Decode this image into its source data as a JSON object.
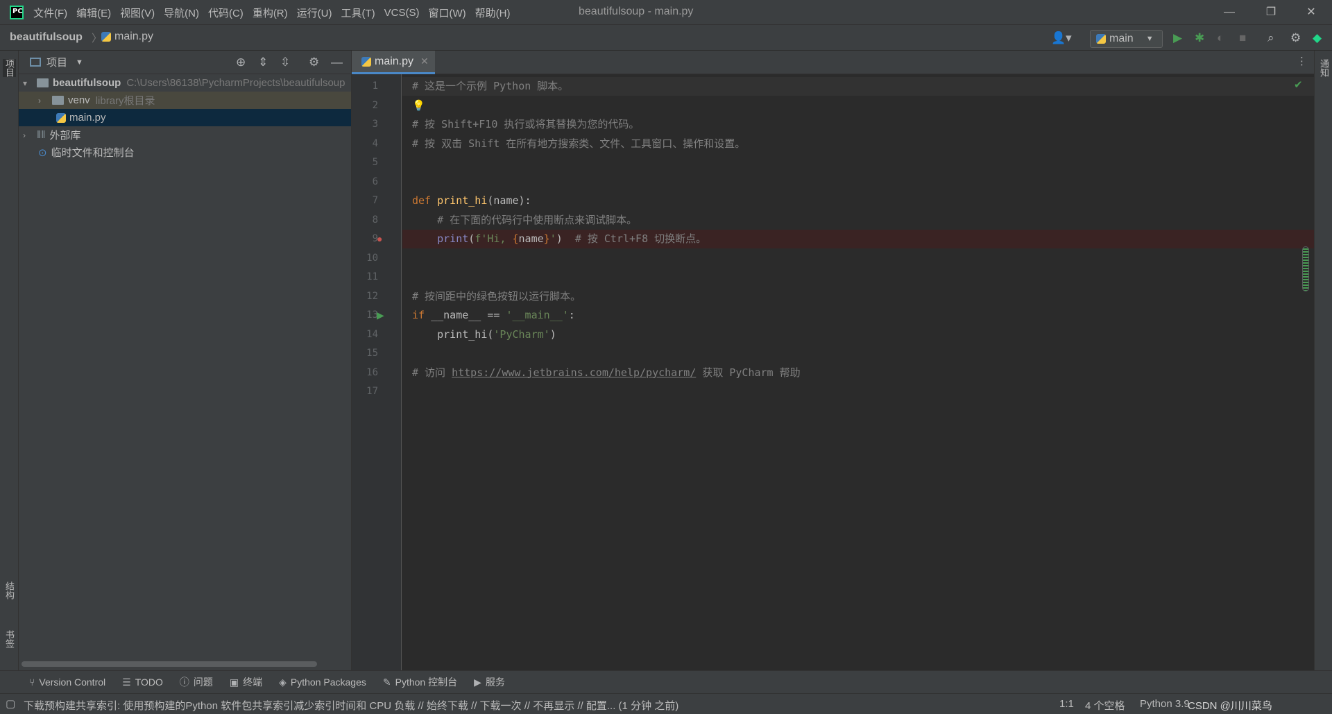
{
  "app": {
    "title": "beautifulsoup - main.py",
    "logo": "PC"
  },
  "menu": [
    "文件(F)",
    "编辑(E)",
    "视图(V)",
    "导航(N)",
    "代码(C)",
    "重构(R)",
    "运行(U)",
    "工具(T)",
    "VCS(S)",
    "窗口(W)",
    "帮助(H)"
  ],
  "nav": {
    "project": "beautifulsoup",
    "separator": "〉",
    "file": "main.py",
    "run_config": "main"
  },
  "left_strip": {
    "project": "项目",
    "structure": "结构",
    "bookmarks": "书签"
  },
  "right_strip": {
    "notifications": "通知"
  },
  "project_panel": {
    "title": "项目",
    "root_name": "beautifulsoup",
    "root_path": "C:\\Users\\86138\\PycharmProjects\\beautifulsoup",
    "venv": "venv",
    "venv_hint": "library根目录",
    "file": "main.py",
    "external": "外部库",
    "scratches": "临时文件和控制台"
  },
  "editor": {
    "tab": "main.py"
  },
  "code_lines": [
    {
      "n": "1",
      "parts": [
        {
          "c": "cmt",
          "t": "# 这是一个示例 Python 脚本。"
        }
      ]
    },
    {
      "n": "2",
      "parts": []
    },
    {
      "n": "3",
      "parts": [
        {
          "c": "cmt",
          "t": "# 按 Shift+F10 执行或将其替换为您的代码。"
        }
      ]
    },
    {
      "n": "4",
      "parts": [
        {
          "c": "cmt",
          "t": "# 按 双击 Shift 在所有地方搜索类、文件、工具窗口、操作和设置。"
        }
      ]
    },
    {
      "n": "5",
      "parts": []
    },
    {
      "n": "6",
      "parts": []
    },
    {
      "n": "7",
      "parts": [
        {
          "c": "kw",
          "t": "def "
        },
        {
          "c": "fn",
          "t": "print_hi"
        },
        {
          "c": "",
          "t": "(name):"
        }
      ]
    },
    {
      "n": "8",
      "parts": [
        {
          "c": "cmt",
          "t": "    # 在下面的代码行中使用断点来调试脚本。"
        }
      ]
    },
    {
      "n": "9",
      "parts": [
        {
          "c": "",
          "t": "    "
        },
        {
          "c": "bi",
          "t": "print"
        },
        {
          "c": "",
          "t": "("
        },
        {
          "c": "str",
          "t": "f'Hi, "
        },
        {
          "c": "kw",
          "t": "{"
        },
        {
          "c": "",
          "t": "name"
        },
        {
          "c": "kw",
          "t": "}"
        },
        {
          "c": "str",
          "t": "'"
        },
        {
          "c": "",
          "t": ")  "
        },
        {
          "c": "cmt",
          "t": "# 按 Ctrl+F8 切换断点。"
        }
      ]
    },
    {
      "n": "10",
      "parts": []
    },
    {
      "n": "11",
      "parts": []
    },
    {
      "n": "12",
      "parts": [
        {
          "c": "cmt",
          "t": "# 按间距中的绿色按钮以运行脚本。"
        }
      ]
    },
    {
      "n": "13",
      "parts": [
        {
          "c": "kw",
          "t": "if "
        },
        {
          "c": "",
          "t": "__name__ == "
        },
        {
          "c": "str",
          "t": "'__main__'"
        },
        {
          "c": "",
          "t": ":"
        }
      ]
    },
    {
      "n": "14",
      "parts": [
        {
          "c": "",
          "t": "    print_hi("
        },
        {
          "c": "str",
          "t": "'PyCharm'"
        },
        {
          "c": "",
          "t": ")"
        }
      ]
    },
    {
      "n": "15",
      "parts": []
    },
    {
      "n": "16",
      "parts": [
        {
          "c": "cmt",
          "t": "# 访问 "
        },
        {
          "c": "url",
          "t": "https://www.jetbrains.com/help/pycharm/"
        },
        {
          "c": "cmt",
          "t": " 获取 PyCharm 帮助"
        }
      ]
    },
    {
      "n": "17",
      "parts": []
    }
  ],
  "tool_windows": [
    "Version Control",
    "TODO",
    "问题",
    "终端",
    "Python Packages",
    "Python 控制台",
    "服务"
  ],
  "status": {
    "message": "下载预构建共享索引: 使用预构建的Python 软件包共享索引减少索引时间和 CPU 负载 // 始终下载 // 下载一次 // 不再显示 // 配置... (1 分钟 之前)",
    "position": "1:1",
    "indent": "4 个空格",
    "interpreter": "Python 3.9",
    "watermark": "CSDN @川川菜鸟"
  },
  "colors": {
    "accent": "#4a88c7",
    "breakpoint": "#c75450",
    "run": "#499c54"
  }
}
